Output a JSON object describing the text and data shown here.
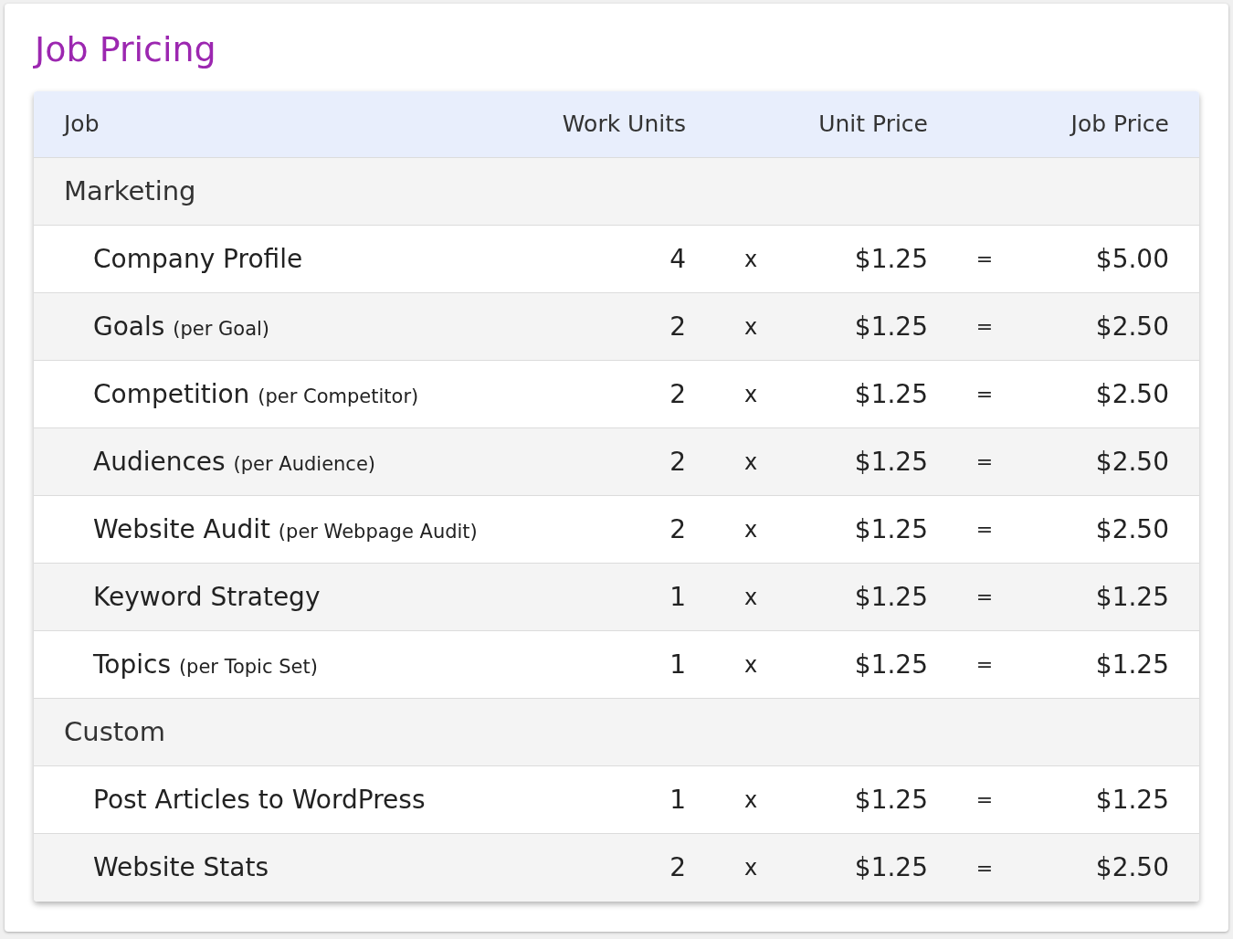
{
  "title": "Job Pricing",
  "table": {
    "columns": [
      "Job",
      "Work Units",
      "Unit Price",
      "Job Price"
    ],
    "rows": [
      {
        "kind": "group",
        "name": "Marketing"
      },
      {
        "kind": "item",
        "name": "Company Profile",
        "units": "4",
        "times": "x",
        "unit_price": "$1.25",
        "equals": "=",
        "job_price": "$5.00"
      },
      {
        "kind": "item",
        "name": "Goals",
        "note": "(per Goal)",
        "units": "2",
        "times": "x",
        "unit_price": "$1.25",
        "equals": "=",
        "job_price": "$2.50"
      },
      {
        "kind": "item",
        "name": "Competition",
        "note": "(per Competitor)",
        "units": "2",
        "times": "x",
        "unit_price": "$1.25",
        "equals": "=",
        "job_price": "$2.50"
      },
      {
        "kind": "item",
        "name": "Audiences",
        "note": "(per Audience)",
        "units": "2",
        "times": "x",
        "unit_price": "$1.25",
        "equals": "=",
        "job_price": "$2.50"
      },
      {
        "kind": "item",
        "name": "Website Audit",
        "note": "(per Webpage Audit)",
        "units": "2",
        "times": "x",
        "unit_price": "$1.25",
        "equals": "=",
        "job_price": "$2.50"
      },
      {
        "kind": "item",
        "name": "Keyword Strategy",
        "units": "1",
        "times": "x",
        "unit_price": "$1.25",
        "equals": "=",
        "job_price": "$1.25"
      },
      {
        "kind": "item",
        "name": "Topics",
        "note": "(per Topic Set)",
        "units": "1",
        "times": "x",
        "unit_price": "$1.25",
        "equals": "=",
        "job_price": "$1.25"
      },
      {
        "kind": "group",
        "name": "Custom"
      },
      {
        "kind": "item",
        "name": "Post Articles to WordPress",
        "units": "1",
        "times": "x",
        "unit_price": "$1.25",
        "equals": "=",
        "job_price": "$1.25"
      },
      {
        "kind": "item",
        "name": "Website Stats",
        "units": "2",
        "times": "x",
        "unit_price": "$1.25",
        "equals": "=",
        "job_price": "$2.50"
      }
    ]
  }
}
